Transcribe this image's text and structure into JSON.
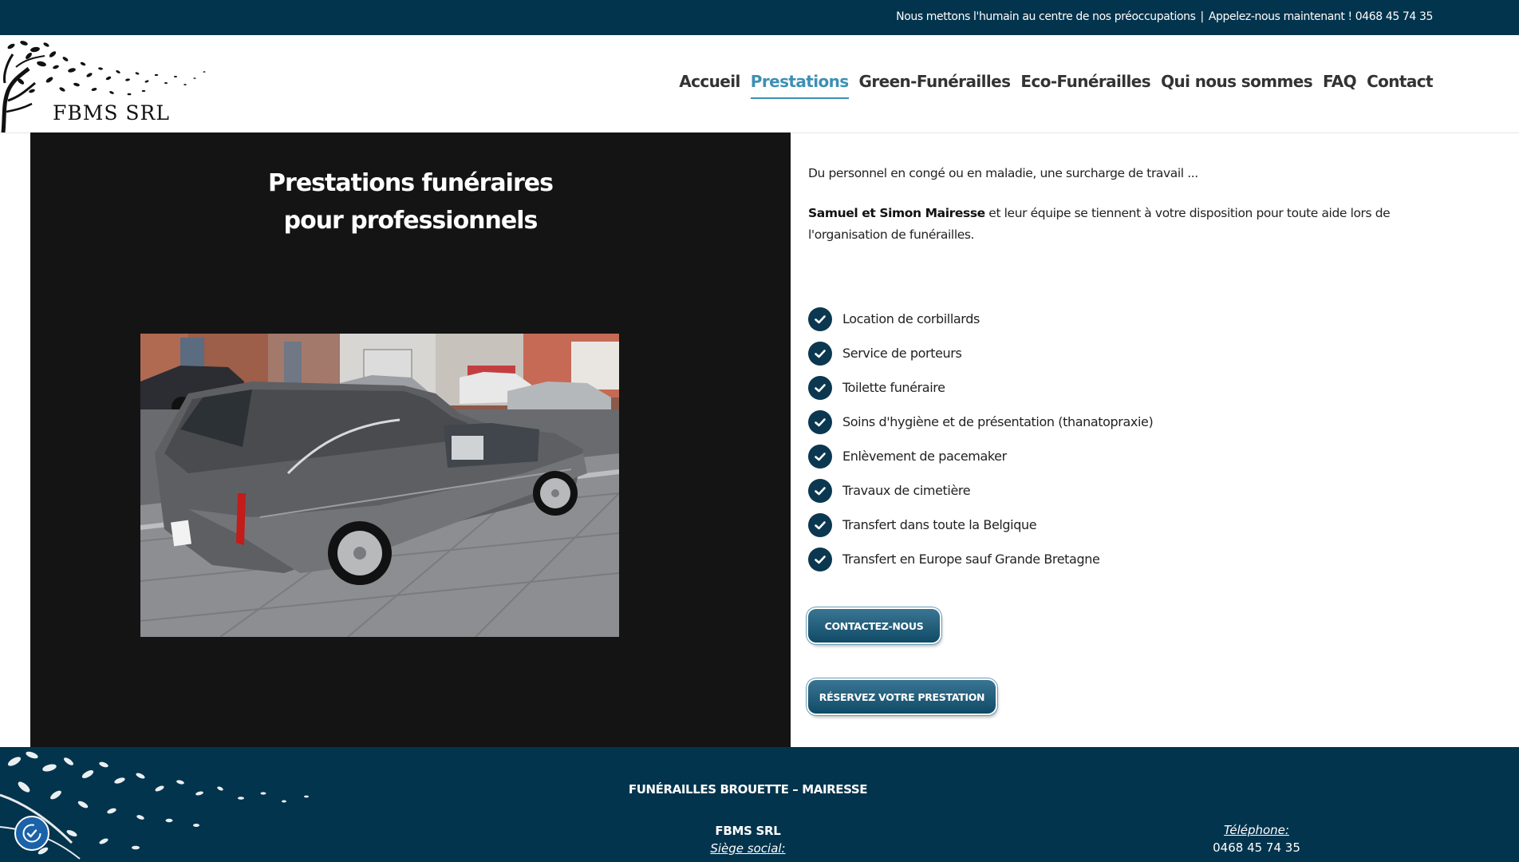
{
  "topbar": {
    "tagline": "Nous mettons l'humain au centre de nos préoccupations",
    "separator": "|",
    "call": "Appelez-nous maintenant ! 0468 45 74 35"
  },
  "header": {
    "logo_text": "FBMS SRL",
    "nav": [
      {
        "label": "Accueil",
        "active": false
      },
      {
        "label": "Prestations",
        "active": true
      },
      {
        "label": "Green-Funérailles",
        "active": false
      },
      {
        "label": "Eco-Funérailles",
        "active": false
      },
      {
        "label": "Qui nous sommes",
        "active": false
      },
      {
        "label": "FAQ",
        "active": false
      },
      {
        "label": "Contact",
        "active": false
      }
    ]
  },
  "main": {
    "title_line1": "Prestations funéraires",
    "title_line2": "pour professionnels",
    "intro": "Du personnel en congé ou en maladie, une surcharge de travail ...",
    "para_bold": "Samuel et Simon Mairesse",
    "para_rest": " et leur équipe se tiennent à votre disposition pour toute aide lors de l'organisation de funérailles.",
    "services": [
      "Location de corbillards",
      "Service de porteurs",
      "Toilette funéraire",
      "Soins d'hygiène et de présentation (thanatopraxie)",
      "Enlèvement de pacemaker",
      "Travaux de cimetière",
      "Transfert dans toute la Belgique",
      "Transfert en Europe sauf Grande Bretagne"
    ],
    "btn_contact": "CONTACTEZ-NOUS",
    "btn_reserve": "RÉSERVEZ VOTRE PRESTATION"
  },
  "footer": {
    "brand": "FUNÉRAILLES BROUETTE – MAIRESSE",
    "company": "FBMS SRL",
    "siege_label": "Siège social:",
    "phone_label": "Téléphone:",
    "phone": "0468 45 74 35"
  },
  "colors": {
    "navy": "#03344d",
    "accent": "#3d8fb5",
    "check": "#0b3850"
  }
}
